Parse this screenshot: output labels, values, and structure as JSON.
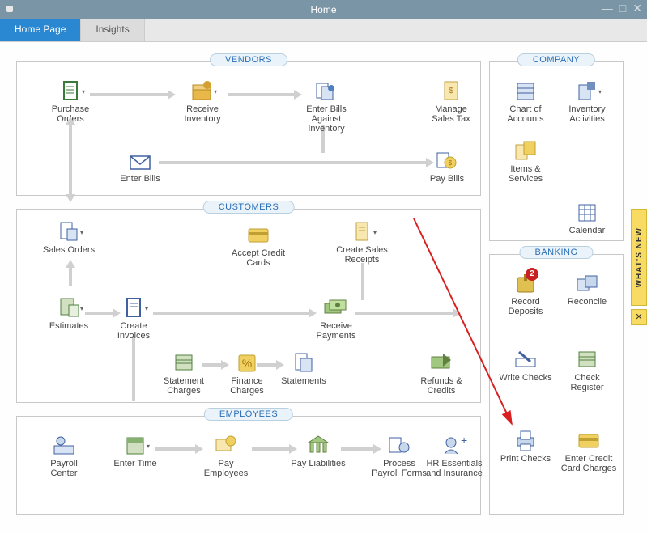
{
  "window": {
    "title": "Home"
  },
  "tabs": {
    "home": "Home Page",
    "insights": "Insights"
  },
  "whats_new": "WHAT'S NEW",
  "vendors": {
    "title": "VENDORS",
    "purchase_orders": "Purchase Orders",
    "receive_inventory": "Receive Inventory",
    "enter_bills_against_inventory": "Enter Bills Against Inventory",
    "manage_sales_tax": "Manage Sales Tax",
    "enter_bills": "Enter Bills",
    "pay_bills": "Pay Bills"
  },
  "customers": {
    "title": "CUSTOMERS",
    "sales_orders": "Sales Orders",
    "accept_credit_cards": "Accept Credit Cards",
    "create_sales_receipts": "Create Sales Receipts",
    "estimates": "Estimates",
    "create_invoices": "Create Invoices",
    "receive_payments": "Receive Payments",
    "refunds_credits": "Refunds & Credits",
    "statement_charges": "Statement Charges",
    "finance_charges": "Finance Charges",
    "statements": "Statements"
  },
  "employees": {
    "title": "EMPLOYEES",
    "payroll_center": "Payroll Center",
    "enter_time": "Enter Time",
    "pay_employees": "Pay Employees",
    "pay_liabilities": "Pay Liabilities",
    "process_payroll_forms": "Process Payroll Forms",
    "hr_essentials": "HR Essentials and Insurance"
  },
  "company": {
    "title": "COMPANY",
    "chart_of_accounts": "Chart of Accounts",
    "inventory_activities": "Inventory Activities",
    "items_services": "Items & Services",
    "calendar": "Calendar"
  },
  "banking": {
    "title": "BANKING",
    "record_deposits": "Record Deposits",
    "deposits_badge": "2",
    "reconcile": "Reconcile",
    "write_checks": "Write Checks",
    "check_register": "Check Register",
    "print_checks": "Print Checks",
    "enter_credit_card_charges": "Enter Credit Card Charges"
  }
}
